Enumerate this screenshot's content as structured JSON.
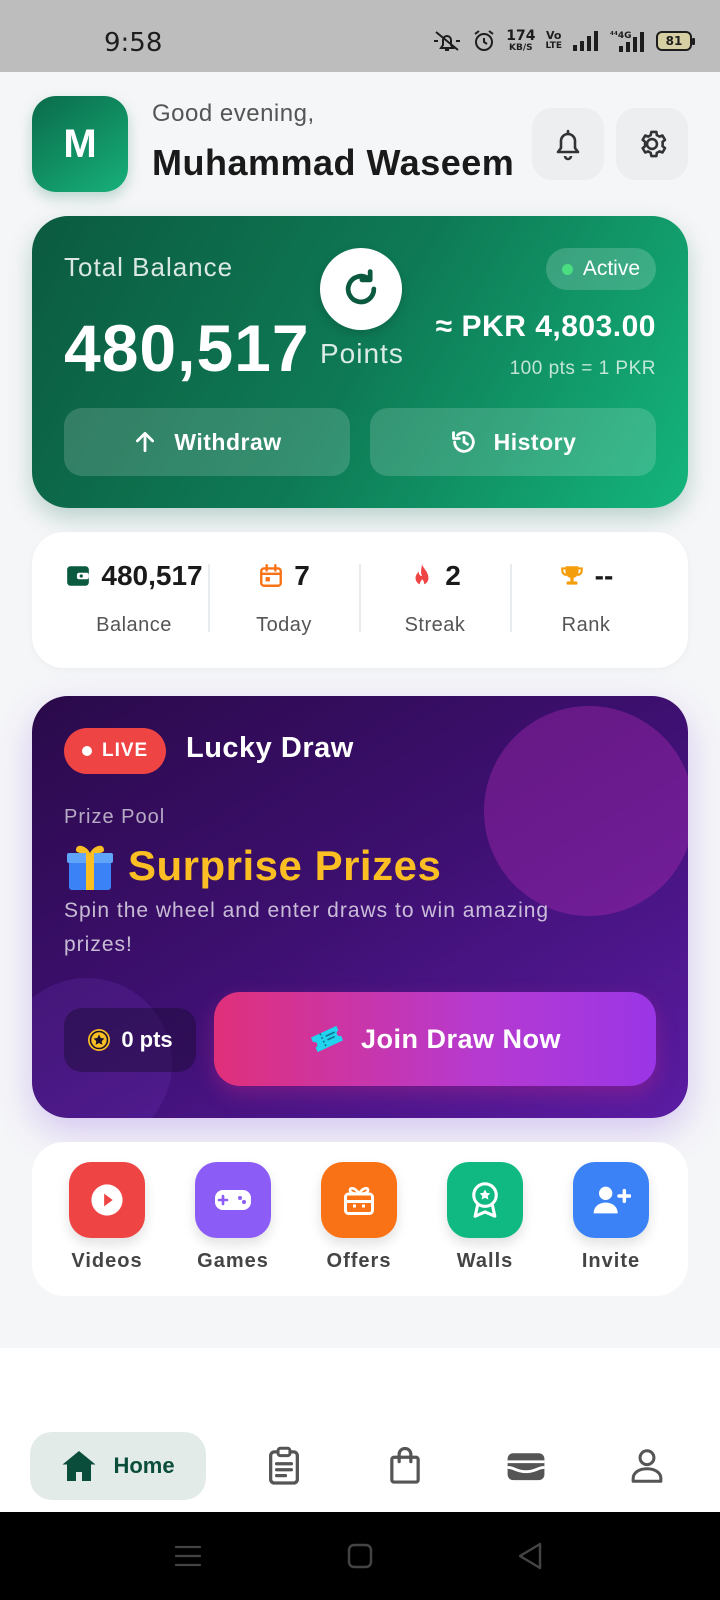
{
  "status_bar": {
    "time": "9:58",
    "net_speed_value": "174",
    "net_speed_unit": "KB/S",
    "volte_top": "Vo",
    "volte_bottom": "LTE",
    "battery": "81"
  },
  "header": {
    "avatar_initial": "M",
    "greeting": "Good evening,",
    "user_name": "Muhammad Waseem"
  },
  "balance_card": {
    "label": "Total Balance",
    "points": "480,517",
    "points_unit": "Points",
    "status": "Active",
    "pkr_value": "≈ PKR 4,803.00",
    "rate": "100 pts = 1 PKR",
    "withdraw_label": "Withdraw",
    "history_label": "History"
  },
  "stats": [
    {
      "value": "480,517",
      "label": "Balance",
      "icon": "wallet-icon"
    },
    {
      "value": "7",
      "label": "Today",
      "icon": "calendar-icon"
    },
    {
      "value": "2",
      "label": "Streak",
      "icon": "fire-icon"
    },
    {
      "value": "--",
      "label": "Rank",
      "icon": "trophy-icon"
    }
  ],
  "lucky_draw": {
    "live_label": "LIVE",
    "title": "Lucky Draw",
    "pool_label": "Prize Pool",
    "prize_title": "Surprise Prizes",
    "description": "Spin the wheel and enter draws to win amazing prizes!",
    "points": "0 pts",
    "join_label": "Join Draw Now"
  },
  "quick_actions": [
    {
      "label": "Videos",
      "color": "#ef4444",
      "icon": "play-icon"
    },
    {
      "label": "Games",
      "color": "#8b5cf6",
      "icon": "gamepad-icon"
    },
    {
      "label": "Offers",
      "color": "#f97316",
      "icon": "gift-icon"
    },
    {
      "label": "Walls",
      "color": "#10b981",
      "icon": "badge-icon"
    },
    {
      "label": "Invite",
      "color": "#3b82f6",
      "icon": "add-user-icon"
    }
  ],
  "bottom_nav": {
    "home_label": "Home"
  },
  "colors": {
    "primary_green": "#0e7a55",
    "accent_purple": "#5b1ca3",
    "live_red": "#ef4444",
    "prize_gold": "#fbbf24"
  }
}
